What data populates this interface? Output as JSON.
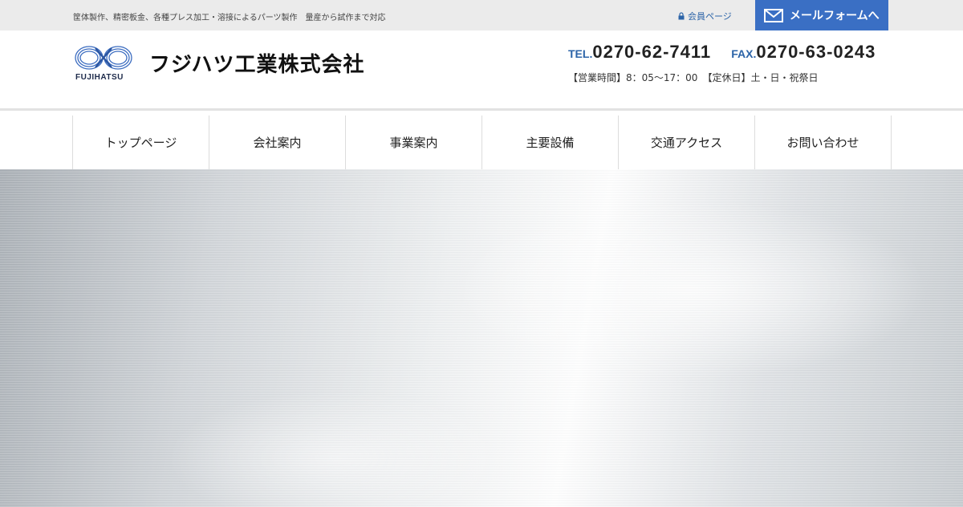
{
  "topbar": {
    "tagline": "筐体製作、精密板金、各種プレス加工・溶接によるパーツ製作　量産から試作まで対応",
    "member_link": "会員ページ",
    "mail_button": "メールフォームへ"
  },
  "header": {
    "logo_text": "FUJIHATSU",
    "company_name": "フジハツ工業株式会社",
    "tel_label": "TEL.",
    "tel_number": "0270-62-7411",
    "fax_label": "FAX.",
    "fax_number": "0270-63-0243",
    "hours": "【営業時間】8：05～17：00　【定休日】土・日・祝祭日"
  },
  "nav": {
    "items": [
      {
        "label": "トップページ"
      },
      {
        "label": "会社案内"
      },
      {
        "label": "事業案内"
      },
      {
        "label": "主要設備"
      },
      {
        "label": "交通アクセス"
      },
      {
        "label": "お問い合わせ"
      }
    ]
  },
  "colors": {
    "accent": "#3a6fc4",
    "link": "#2c64a8",
    "topbar_bg": "#ebebeb"
  }
}
